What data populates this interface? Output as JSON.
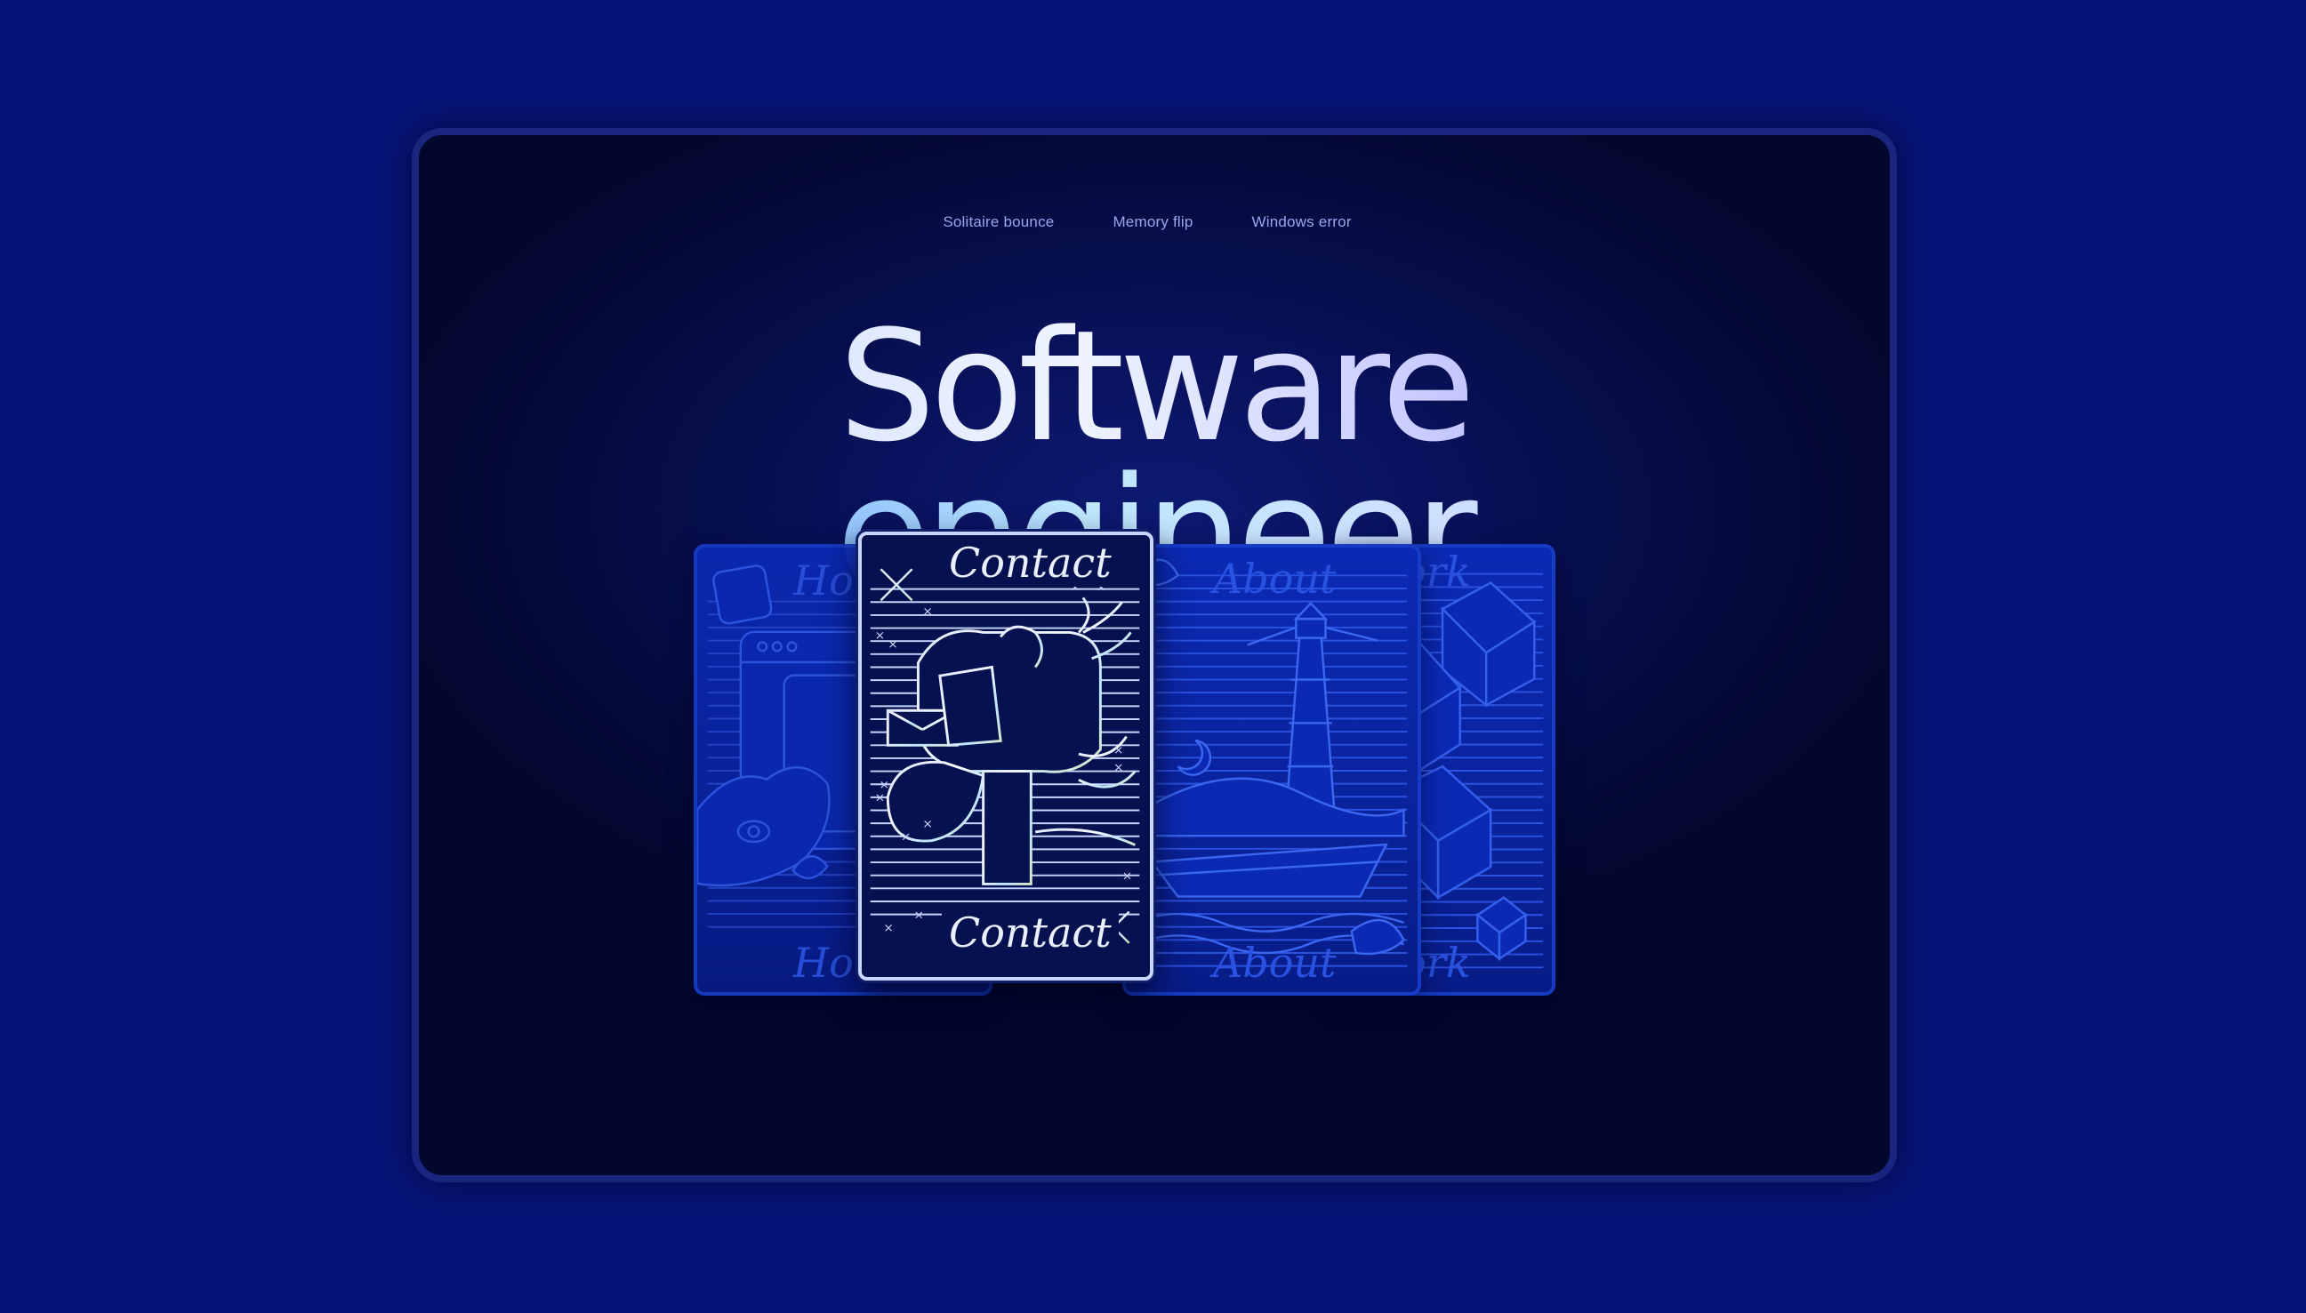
{
  "nav": {
    "links": [
      "Solitaire bounce",
      "Memory flip",
      "Windows error"
    ]
  },
  "hero": {
    "line1": "Software",
    "line2": "engineer"
  },
  "cards": {
    "home": {
      "label_top": "Home",
      "label_bottom": "Home"
    },
    "contact": {
      "label_top": "Contact",
      "label_bottom": "Contact"
    },
    "about": {
      "label_top": "About",
      "label_bottom": "About"
    },
    "work": {
      "label_top": "Work",
      "label_bottom": "Work"
    }
  },
  "colors": {
    "page_background": "#071477",
    "frame_background": "#040a3a",
    "frame_border": "#1a257f",
    "nav_link": "#9aa6ec",
    "card_back": "#0b2ab4",
    "card_back_line": "#2a52e0",
    "card_front_line": "#c7d6ff"
  },
  "icons": [
    "snowflake-icon",
    "mailbox-icon",
    "lighthouse-icon",
    "boat-icon",
    "shell-icon",
    "cube-icon",
    "keyboard-key-icon",
    "browser-window-icon",
    "cat-icon"
  ]
}
